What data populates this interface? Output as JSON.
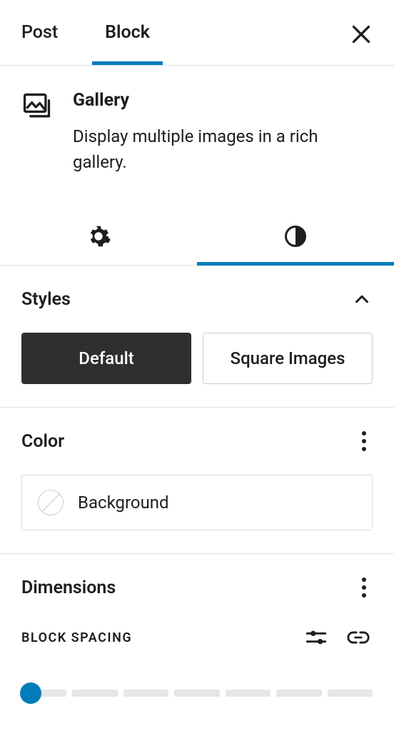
{
  "tabs": {
    "post": "Post",
    "block": "Block"
  },
  "block": {
    "title": "Gallery",
    "description": "Display multiple images in a rich gallery."
  },
  "sections": {
    "styles_title": "Styles",
    "color_title": "Color",
    "dimensions_title": "Dimensions",
    "block_spacing_label": "BLOCK SPACING"
  },
  "style_variants": {
    "default": "Default",
    "square": "Square Images"
  },
  "color": {
    "background_label": "Background"
  },
  "colors": {
    "accent": "#007cba"
  }
}
